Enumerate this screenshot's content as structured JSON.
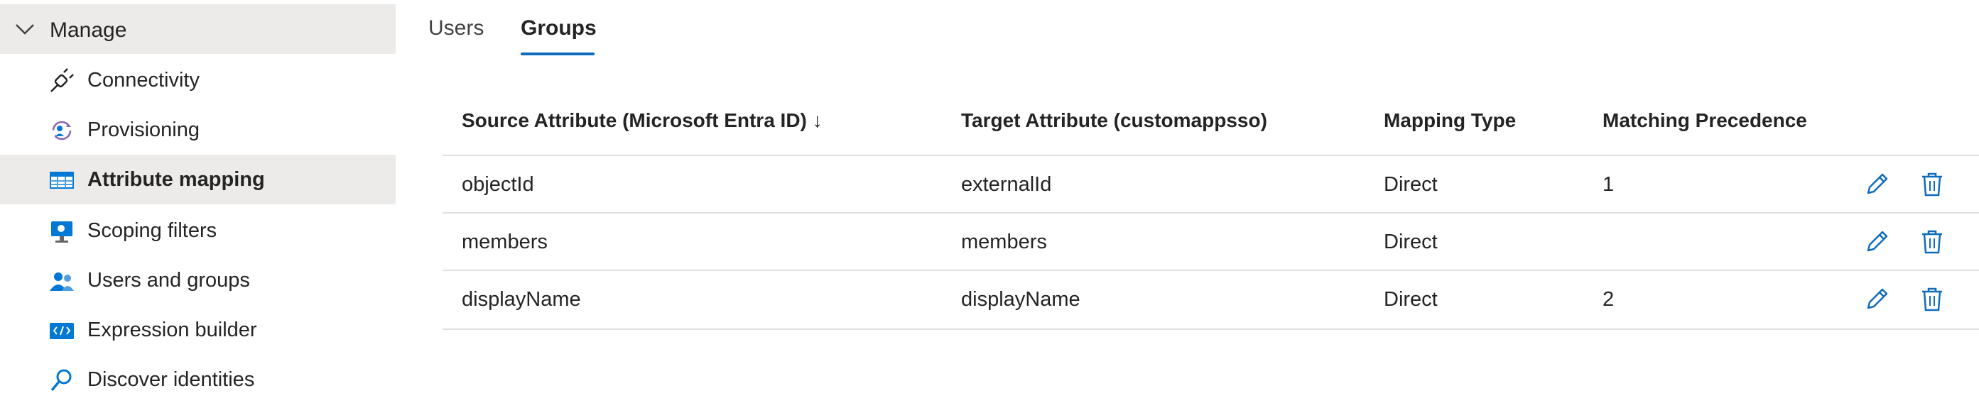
{
  "sidebar": {
    "section_label": "Manage",
    "items": [
      {
        "label": "Connectivity",
        "icon": "plug-icon",
        "selected": false
      },
      {
        "label": "Provisioning",
        "icon": "provisioning-icon",
        "selected": false
      },
      {
        "label": "Attribute mapping",
        "icon": "table-icon",
        "selected": true
      },
      {
        "label": "Scoping filters",
        "icon": "monitor-icon",
        "selected": false
      },
      {
        "label": "Users and groups",
        "icon": "users-icon",
        "selected": false
      },
      {
        "label": "Expression builder",
        "icon": "code-icon",
        "selected": false
      },
      {
        "label": "Discover identities",
        "icon": "search-icon",
        "selected": false
      }
    ]
  },
  "tabs": [
    {
      "label": "Users",
      "active": false
    },
    {
      "label": "Groups",
      "active": true
    }
  ],
  "table": {
    "headers": {
      "source": "Source Attribute (Microsoft Entra ID) ↓",
      "target": "Target Attribute (customappsso)",
      "type": "Mapping Type",
      "precedence": "Matching Precedence"
    },
    "rows": [
      {
        "source": "objectId",
        "target": "externalId",
        "type": "Direct",
        "precedence": "1"
      },
      {
        "source": "members",
        "target": "members",
        "type": "Direct",
        "precedence": ""
      },
      {
        "source": "displayName",
        "target": "displayName",
        "type": "Direct",
        "precedence": "2"
      }
    ]
  },
  "colors": {
    "accent": "#0f6cbd",
    "selected_bg": "#edebe9",
    "divider": "#e1dfdd"
  }
}
